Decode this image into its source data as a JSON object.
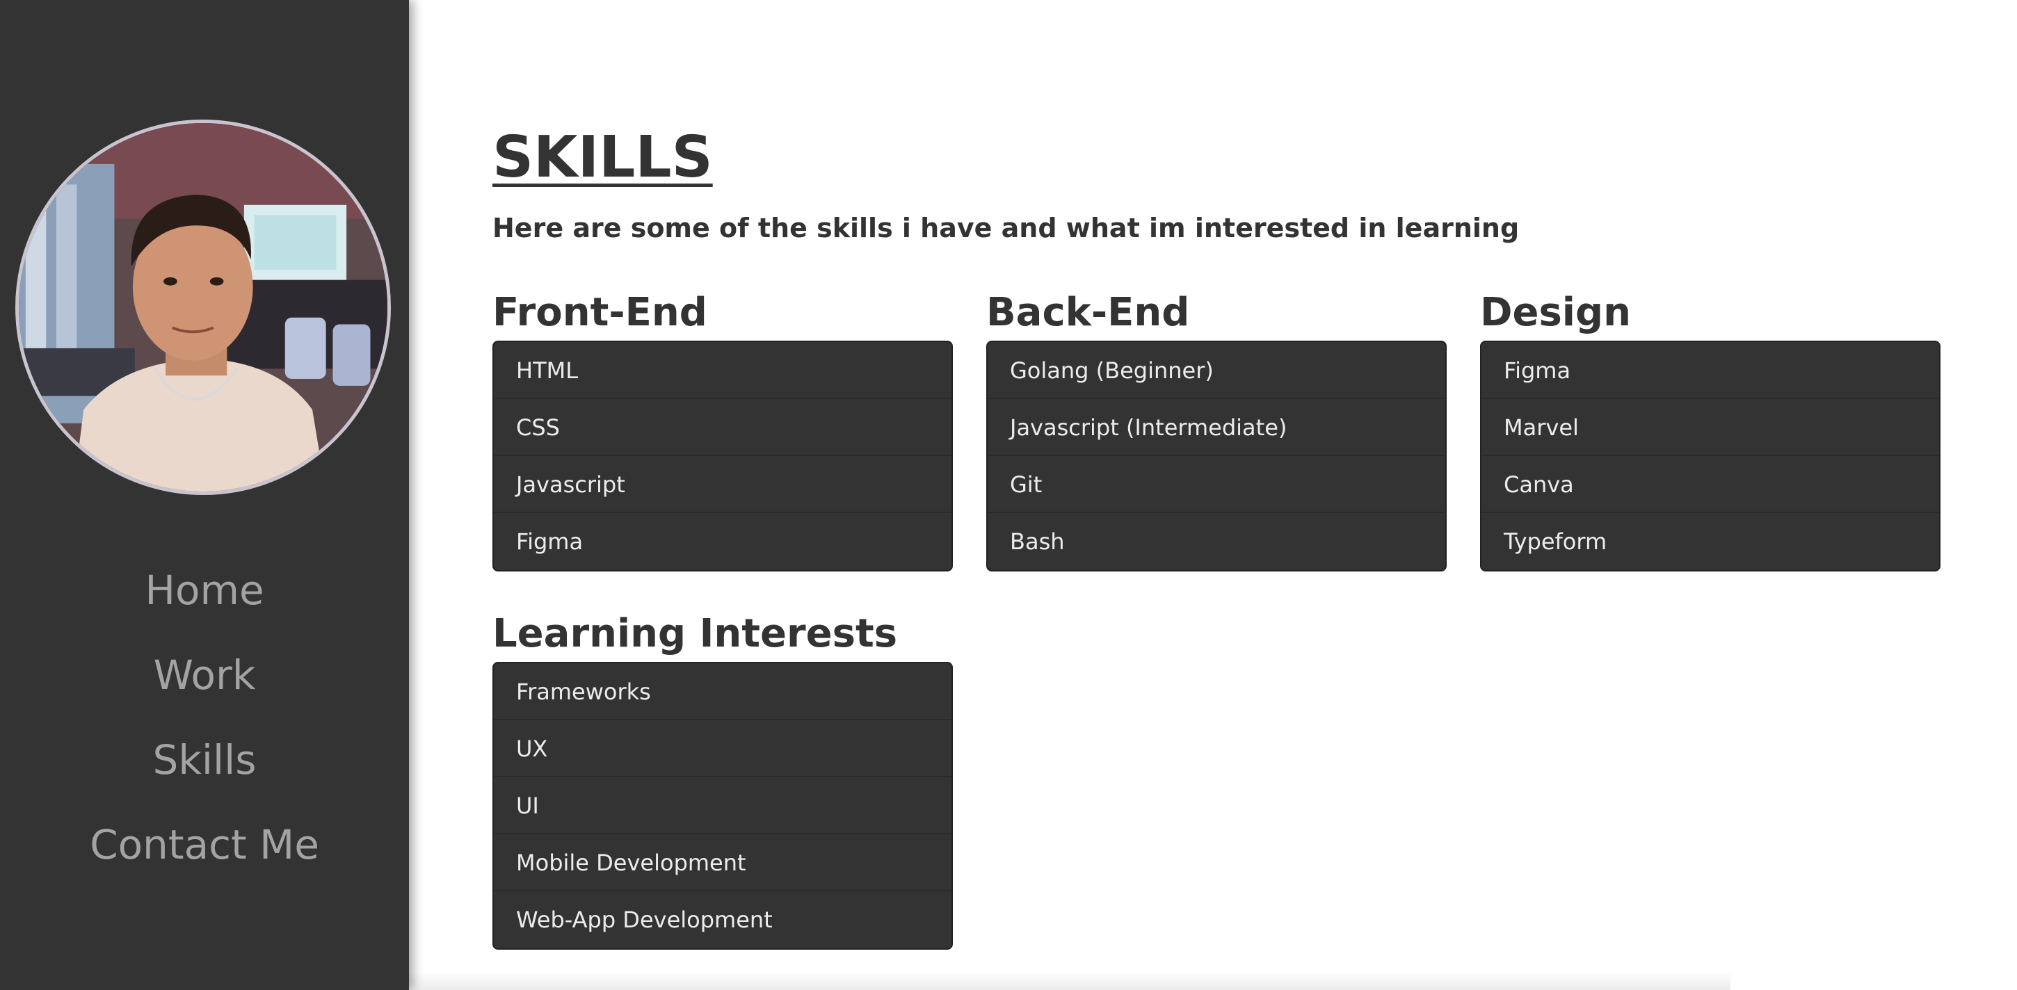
{
  "sidebar": {
    "nav": [
      {
        "label": "Home"
      },
      {
        "label": "Work"
      },
      {
        "label": "Skills"
      },
      {
        "label": "Contact Me"
      }
    ]
  },
  "main": {
    "title": "SKILLS",
    "subtitle": "Here are some of the skills i have and what im interested in learning",
    "groups": [
      {
        "heading": "Front-End",
        "items": [
          "HTML",
          "CSS",
          "Javascript",
          "Figma"
        ]
      },
      {
        "heading": "Back-End",
        "items": [
          "Golang (Beginner)",
          "Javascript (Intermediate)",
          "Git",
          "Bash"
        ]
      },
      {
        "heading": "Design",
        "items": [
          "Figma",
          "Marvel",
          "Canva",
          "Typeform"
        ]
      },
      {
        "heading": "Learning Interests",
        "items": [
          "Frameworks",
          "UX",
          "UI",
          "Mobile Development",
          "Web-App Development"
        ]
      }
    ]
  },
  "colors": {
    "sidebar_bg": "#333333",
    "nav_text": "#a3a3a3",
    "heading_text": "#333333",
    "list_bg": "#333333",
    "list_text": "#ececec",
    "page_bg": "#ffffff"
  }
}
